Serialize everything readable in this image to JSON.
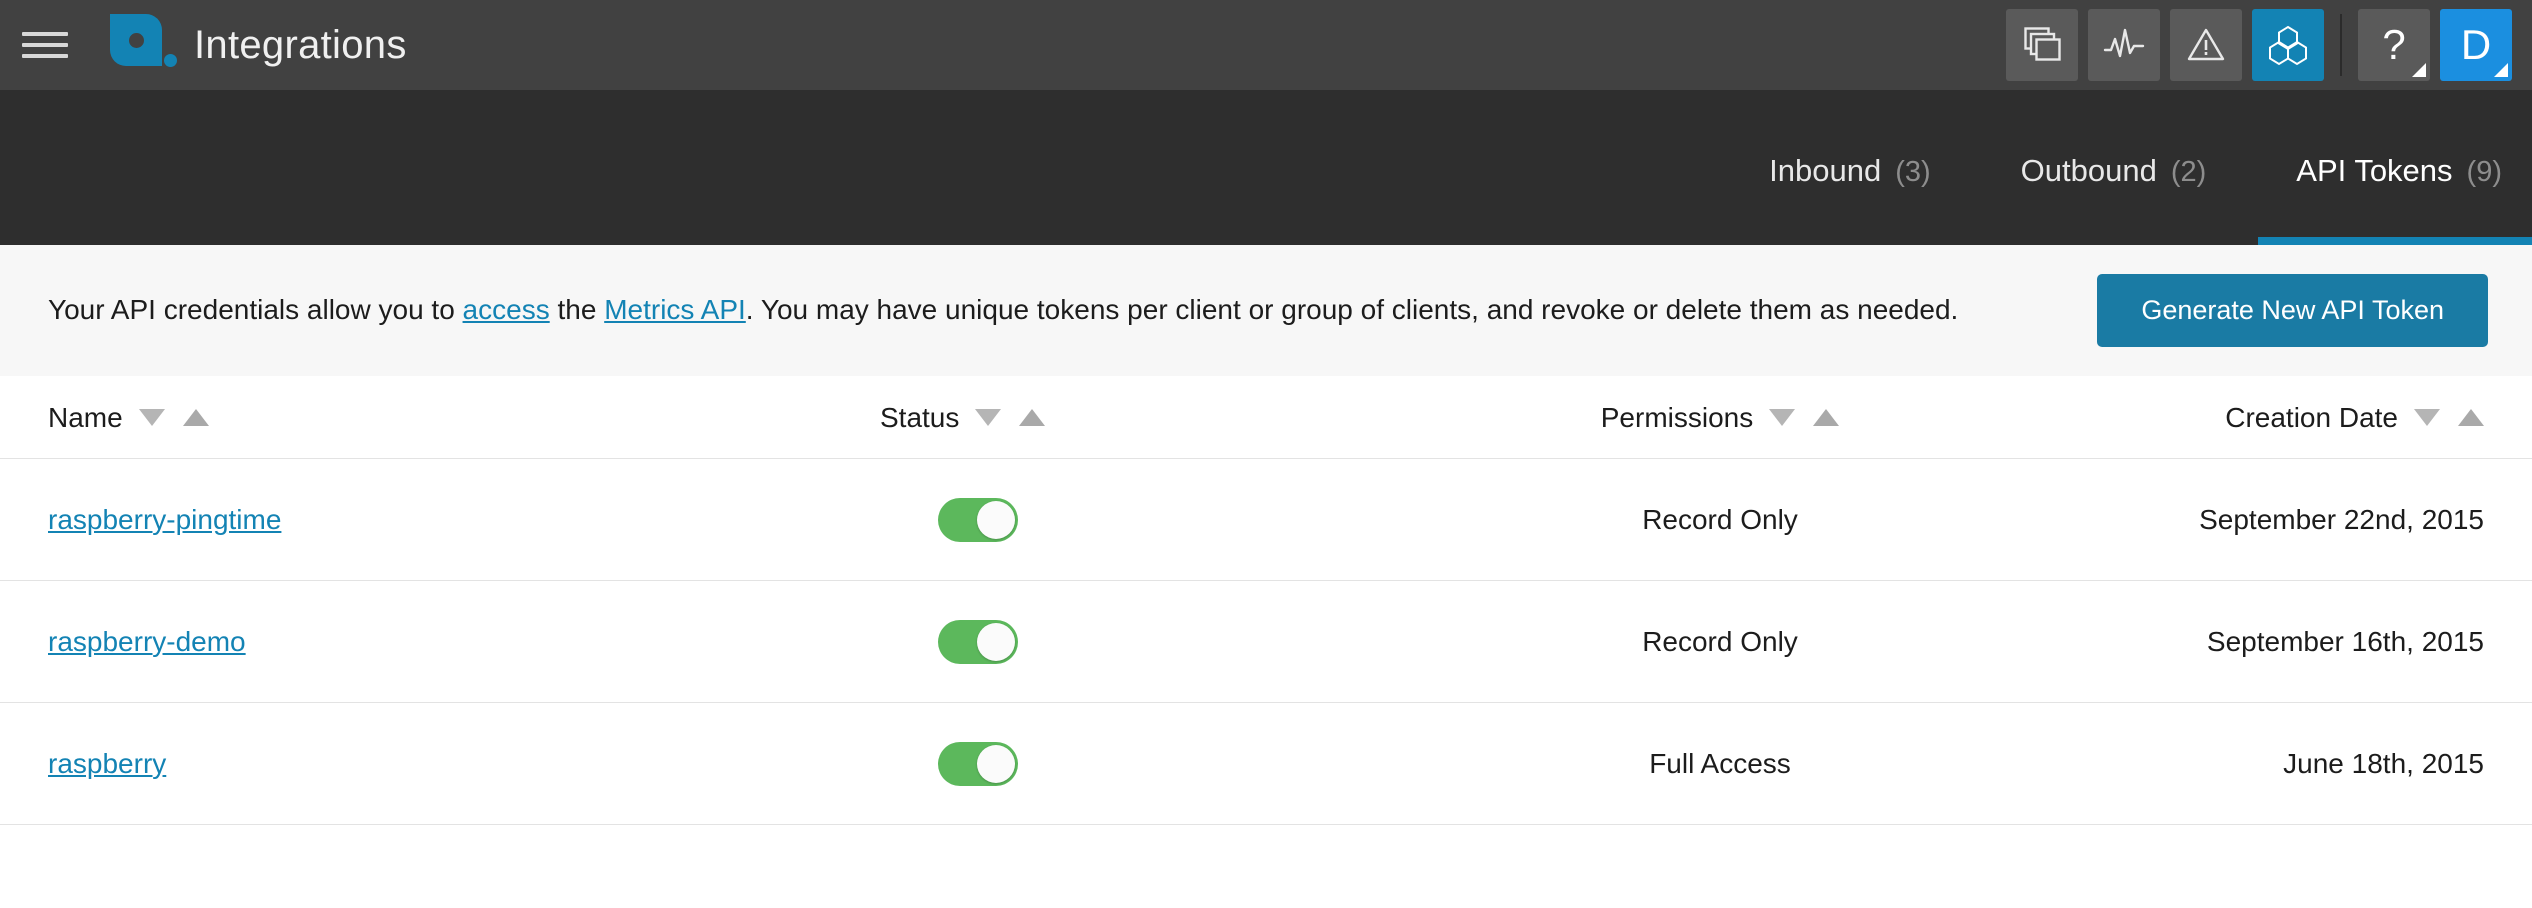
{
  "topbar": {
    "menu_icon": "hamburger-icon",
    "logo_icon": "app-logo-icon",
    "title": "Integrations",
    "nav_buttons": [
      {
        "name": "dashboards",
        "icon": "stacked-windows-icon",
        "active": false
      },
      {
        "name": "metrics",
        "icon": "pulse-waveform-icon",
        "active": false
      },
      {
        "name": "alerts",
        "icon": "warning-triangle-icon",
        "active": false
      },
      {
        "name": "integrations",
        "icon": "hexagons-icon",
        "active": true
      }
    ],
    "help_label": "?",
    "avatar_label": "D",
    "accent_color": "#1383b4",
    "avatar_color": "#1b8fe0",
    "bar_color": "#414141"
  },
  "tabs": [
    {
      "label": "Inbound",
      "count": "(3)",
      "active": false
    },
    {
      "label": "Outbound",
      "count": "(2)",
      "active": false
    },
    {
      "label": "API Tokens",
      "count": "(9)",
      "active": true
    }
  ],
  "banner": {
    "text_part1": "Your API credentials allow you to ",
    "link1": "access",
    "text_part2": " the ",
    "link2": "Metrics API",
    "text_part3": ". You may have unique tokens per client or group of clients, and revoke or delete them as needed.",
    "button_label": "Generate New API Token",
    "button_color": "#1a7ba4",
    "background": "#f7f7f7"
  },
  "table": {
    "columns": [
      {
        "label": "Name",
        "sortable": true
      },
      {
        "label": "Status",
        "sortable": true
      },
      {
        "label": "Permissions",
        "sortable": true
      },
      {
        "label": "Creation Date",
        "sortable": true
      }
    ],
    "rows": [
      {
        "name": "raspberry-pingtime",
        "status": "on",
        "permissions": "Record Only",
        "creation_date": "September 22nd, 2015"
      },
      {
        "name": "raspberry-demo",
        "status": "on",
        "permissions": "Record Only",
        "creation_date": "September 16th, 2015"
      },
      {
        "name": "raspberry",
        "status": "on",
        "permissions": "Full Access",
        "creation_date": "June 18th, 2015"
      }
    ],
    "toggle_on_color": "#5cb85c",
    "link_color": "#1383b4"
  }
}
